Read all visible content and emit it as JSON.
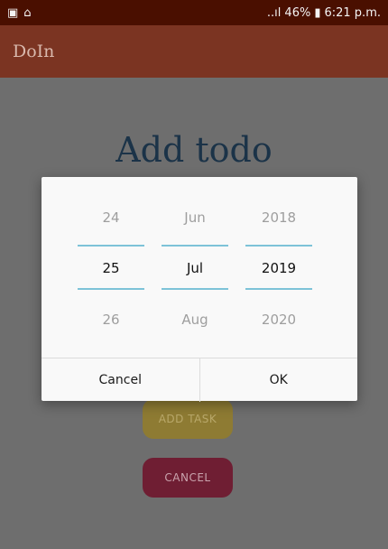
{
  "status_bar": {
    "signal": "..ıl",
    "battery_percent": "46%",
    "time": "6:21 p.m."
  },
  "app_bar": {
    "title": "DoIn"
  },
  "page": {
    "title": "Add todo",
    "add_task_label": "ADD TASK",
    "cancel_label": "CANCEL"
  },
  "date_picker": {
    "day": {
      "prev": "24",
      "current": "25",
      "next": "26"
    },
    "month": {
      "prev": "Jun",
      "current": "Jul",
      "next": "Aug"
    },
    "year": {
      "prev": "2018",
      "current": "2019",
      "next": "2020"
    },
    "cancel_label": "Cancel",
    "ok_label": "OK"
  },
  "colors": {
    "status_bar": "#4a0f00",
    "app_bar": "#7b3422",
    "accent_line": "#7dc3d8",
    "add_button": "#8e7b33",
    "cancel_button": "#6f1e33"
  }
}
